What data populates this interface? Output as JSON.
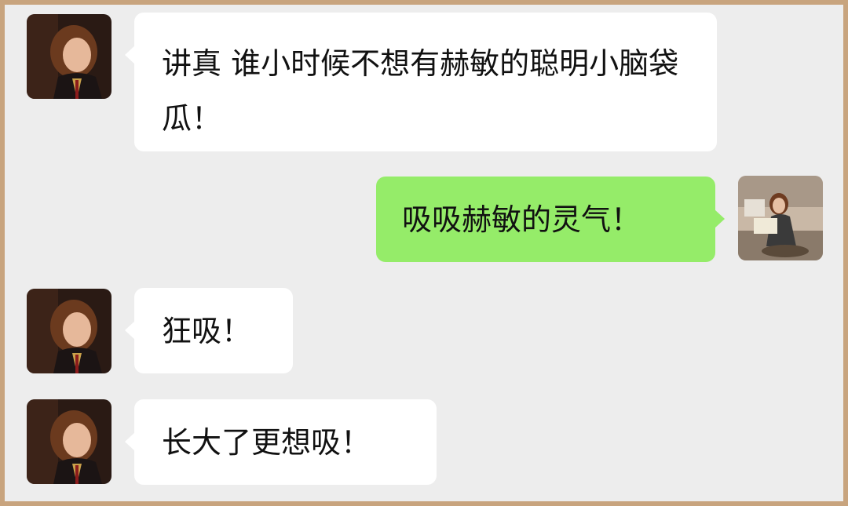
{
  "colors": {
    "frame": "#c8a47e",
    "chat_background": "#ededed",
    "incoming_bubble": "#ffffff",
    "outgoing_bubble": "#95ec69",
    "text": "#111111"
  },
  "messages": [
    {
      "sender": "other",
      "avatar_icon": "girl-portrait-avatar",
      "text": "讲真 谁小时候不想有赫敏的聪明小脑袋瓜！"
    },
    {
      "sender": "self",
      "avatar_icon": "girl-reading-avatar",
      "text": "吸吸赫敏的灵气！"
    },
    {
      "sender": "other",
      "avatar_icon": "girl-portrait-avatar",
      "text": "狂吸！"
    },
    {
      "sender": "other",
      "avatar_icon": "girl-portrait-avatar",
      "text": "长大了更想吸！"
    }
  ]
}
